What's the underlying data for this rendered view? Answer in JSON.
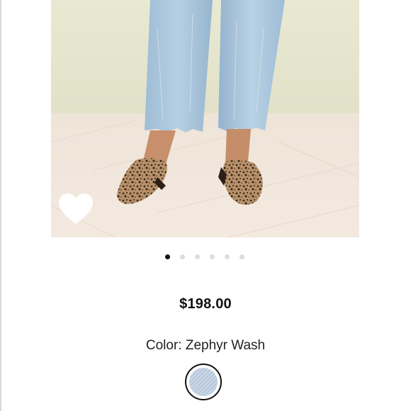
{
  "product": {
    "image": {
      "description_icon": "product-photo",
      "colors": {
        "wall": "#e6e6cf",
        "floor": "#efe3d8",
        "jeans": "#aac6dd",
        "skin": "#c8906c",
        "shoe": "#9b7a55"
      }
    },
    "carousel": {
      "total": 6,
      "active": 1
    },
    "price": "$198.00",
    "color_label": "Color: Zephyr Wash",
    "swatch": {
      "name": "Zephyr Wash",
      "hex": "#c4d2e4",
      "selected": true
    },
    "wishlist_icon": "heart-icon"
  }
}
